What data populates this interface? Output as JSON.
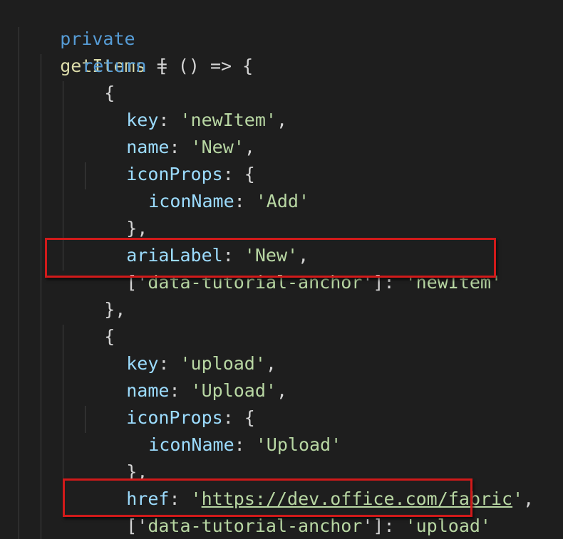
{
  "code": {
    "l1": {
      "kw": "private",
      "fn": "getItems",
      "rest": " = () => {"
    },
    "l2": {
      "kw": "return",
      "rest": " ["
    },
    "l3": {
      "text": "{"
    },
    "l4": {
      "prop": "key",
      "val": "'newItem'"
    },
    "l5": {
      "prop": "name",
      "val": "'New'"
    },
    "l6": {
      "prop": "iconProps",
      "rest": ": {"
    },
    "l7": {
      "prop": "iconName",
      "val": "'Add'"
    },
    "l8": {
      "text": "},"
    },
    "l9": {
      "prop": "ariaLabel",
      "val": "'New'"
    },
    "l10": {
      "open": "['",
      "attr": "data-tutorial-anchor",
      "close": "']",
      "val": "'newItem'"
    },
    "l11": {
      "text": "},"
    },
    "l12": {
      "text": "{"
    },
    "l13": {
      "prop": "key",
      "val": "'upload'"
    },
    "l14": {
      "prop": "name",
      "val": "'Upload'"
    },
    "l15": {
      "prop": "iconProps",
      "rest": ": {"
    },
    "l16": {
      "prop": "iconName",
      "val": "'Upload'"
    },
    "l17": {
      "text": "},"
    },
    "l18": {
      "prop": "href",
      "q1": "'",
      "url": "https://dev.office.com/fabric",
      "q2": "'"
    },
    "l19": {
      "open": "['",
      "attr": "data-tutorial-anchor",
      "close": "']",
      "val": "'upload'"
    },
    "l20": {
      "text": "},"
    }
  },
  "colors": {
    "background": "#1e1e1e",
    "keyword": "#569cd6",
    "function": "#dcdcaa",
    "property": "#9cdcfe",
    "string": "#b8d7a3",
    "highlight_box": "#d11a1a"
  }
}
